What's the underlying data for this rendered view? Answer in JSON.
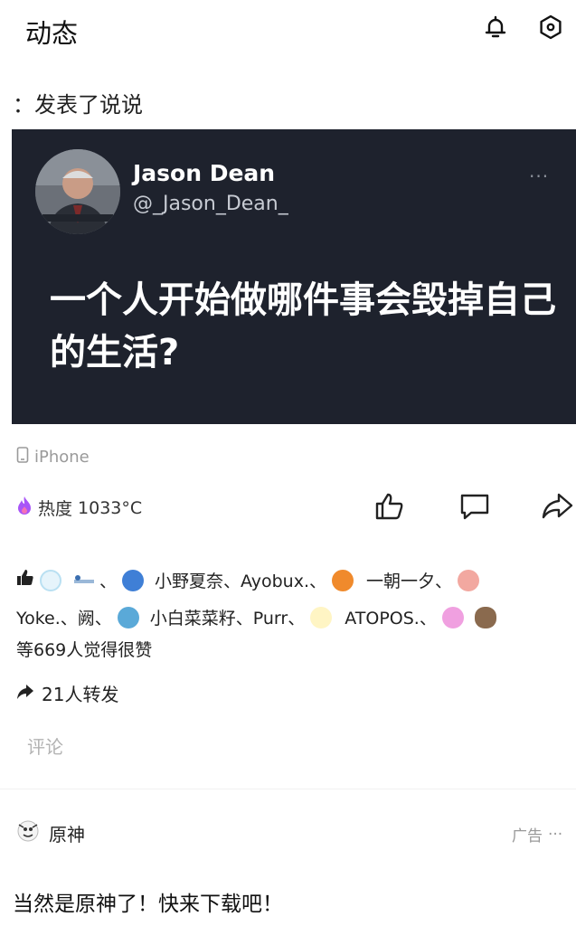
{
  "header": {
    "title": "动态"
  },
  "post": {
    "subtitle": "：发表了说说",
    "tweet": {
      "author_name": "Jason Dean",
      "author_handle": "@_Jason_Dean_",
      "more": "···",
      "text": "一个人开始做哪件事会毁掉自己的生活?"
    },
    "device": "iPhone",
    "heat_label": "热度",
    "heat_value": "1033°C"
  },
  "likes": {
    "line1": {
      "names_a": "小野夏奈、Ayobux.、",
      "names_b": "一朝一夕、"
    },
    "line2": {
      "names_a": "Yoke.、阙、",
      "names_b": "小白菜菜籽、Purr、",
      "names_c": "ATOPOS.、"
    },
    "summary": "等669人觉得很赞",
    "sep": "、"
  },
  "repost": "21人转发",
  "comment_placeholder": "评论",
  "ad": {
    "name": "原神",
    "tag": "广告",
    "more": "···",
    "text": "当然是原神了！快来下载吧！"
  },
  "colors": {
    "card_bg": "#1e222d",
    "heat_icon": "#a855f7"
  }
}
